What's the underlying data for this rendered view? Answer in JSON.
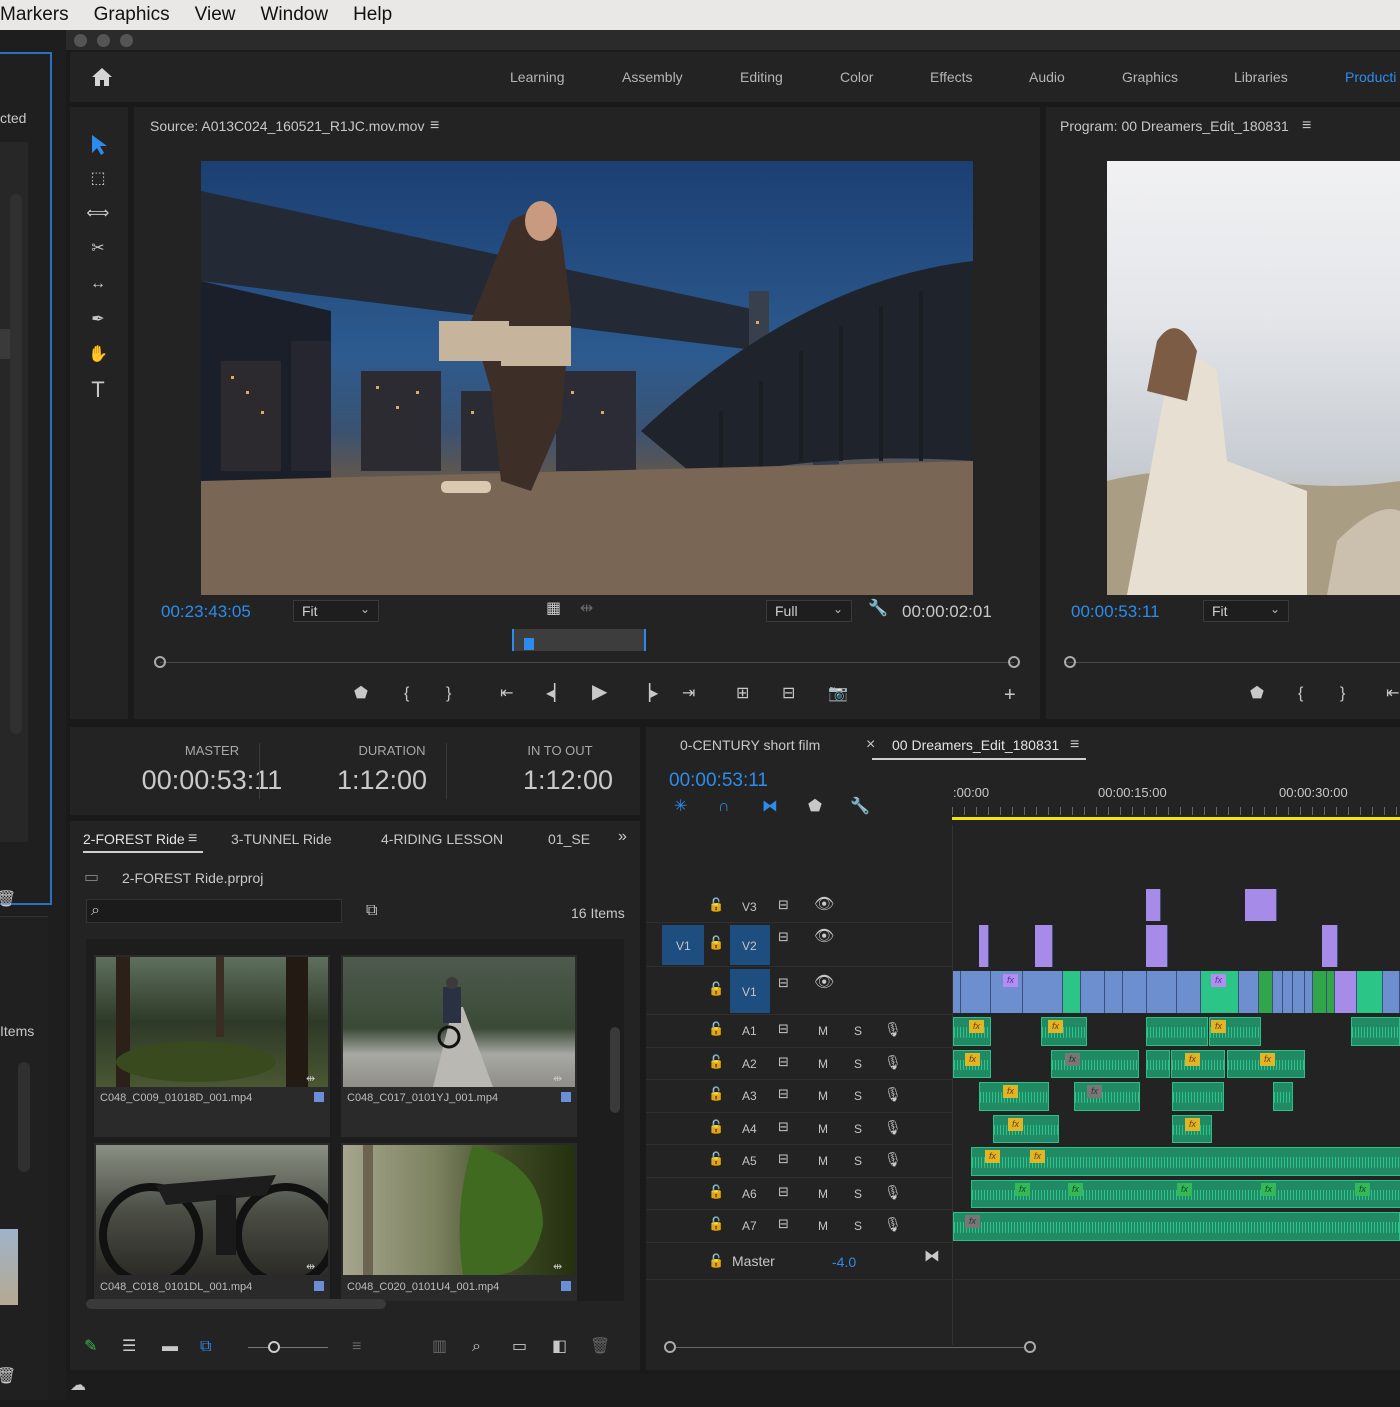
{
  "menu": [
    "Markers",
    "Graphics",
    "View",
    "Window",
    "Help"
  ],
  "workspaces": [
    {
      "label": "Learning",
      "active": false
    },
    {
      "label": "Assembly",
      "active": false
    },
    {
      "label": "Editing",
      "active": false
    },
    {
      "label": "Color",
      "active": false
    },
    {
      "label": "Effects",
      "active": false
    },
    {
      "label": "Audio",
      "active": false
    },
    {
      "label": "Graphics",
      "active": false
    },
    {
      "label": "Libraries",
      "active": false
    },
    {
      "label": "Producti",
      "active": true
    }
  ],
  "left_panel": {
    "partial_text_1": "cted",
    "partial_text_2": "Items"
  },
  "source": {
    "title": "Source: A013C024_160521_R1JC.mov.mov",
    "timecode": "00:23:43:05",
    "fit": "Fit",
    "resolution": "Full",
    "duration": "00:00:02:01"
  },
  "program": {
    "title": "Program: 00 Dreamers_Edit_180831",
    "timecode": "00:00:53:11",
    "fit": "Fit"
  },
  "info": {
    "master_label": "MASTER",
    "master_value": "00:00:53:11",
    "duration_label": "DURATION",
    "duration_value": "1:12:00",
    "inout_label": "IN TO OUT",
    "inout_value": "1:12:00"
  },
  "bins": {
    "tabs": [
      "2-FOREST Ride",
      "3-TUNNEL Ride",
      "4-RIDING LESSON",
      "01_SE"
    ],
    "project_file": "2-FOREST Ride.prproj",
    "item_count": "16 Items",
    "items": [
      "C048_C009_01018D_001.mp4",
      "C048_C017_0101YJ_001.mp4",
      "C048_C018_0101DL_001.mp4",
      "C048_C020_0101U4_001.mp4"
    ]
  },
  "timeline": {
    "tabs": [
      "0-CENTURY short film",
      "00 Dreamers_Edit_180831"
    ],
    "timecode": "00:00:53:11",
    "ruler": [
      ":00:00",
      "00:00:15:00",
      "00:00:30:00"
    ],
    "video_tracks": [
      "V3",
      "V2",
      "V1"
    ],
    "source_patch": "V1",
    "audio_tracks": [
      "A1",
      "A2",
      "A3",
      "A4",
      "A5",
      "A6",
      "A7"
    ],
    "mute_label": "M",
    "solo_label": "S",
    "master_label": "Master",
    "master_value": "-4.0",
    "fx_label": "fx"
  },
  "colors": {
    "accent": "#2d8ceb",
    "video_clip": "#6d8fd0",
    "audio_clip": "#1f8a63",
    "playhead": "#f3e600"
  }
}
